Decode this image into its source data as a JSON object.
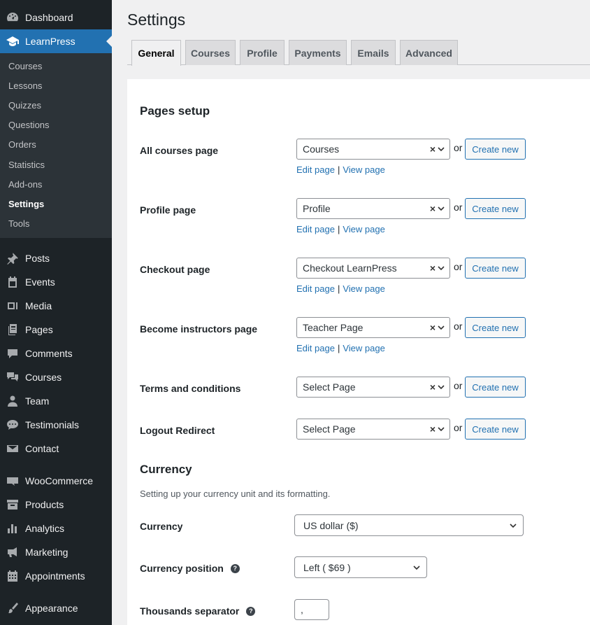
{
  "sidebar": {
    "top_items": [
      {
        "label": "Dashboard",
        "icon": "dashboard-icon"
      },
      {
        "label": "LearnPress",
        "icon": "graduation-cap-icon"
      }
    ],
    "learnpress_sub": [
      "Courses",
      "Lessons",
      "Quizzes",
      "Questions",
      "Orders",
      "Statistics",
      "Add-ons",
      "Settings",
      "Tools"
    ],
    "items_group1": [
      {
        "label": "Posts",
        "icon": "pushpin-icon"
      },
      {
        "label": "Events",
        "icon": "calendar-icon"
      },
      {
        "label": "Media",
        "icon": "media-icon"
      },
      {
        "label": "Pages",
        "icon": "pages-icon"
      },
      {
        "label": "Comments",
        "icon": "comment-icon"
      },
      {
        "label": "Courses",
        "icon": "comments-icon"
      },
      {
        "label": "Team",
        "icon": "person-icon"
      },
      {
        "label": "Testimonials",
        "icon": "speech-bubble-icon"
      },
      {
        "label": "Contact",
        "icon": "envelope-icon"
      }
    ],
    "items_group2": [
      {
        "label": "WooCommerce",
        "icon": "woo-icon"
      },
      {
        "label": "Products",
        "icon": "archive-icon"
      },
      {
        "label": "Analytics",
        "icon": "bar-chart-icon"
      },
      {
        "label": "Marketing",
        "icon": "megaphone-icon"
      },
      {
        "label": "Appointments",
        "icon": "calendar-grid-icon"
      }
    ],
    "items_group3": [
      {
        "label": "Appearance",
        "icon": "paintbrush-icon"
      }
    ]
  },
  "page": {
    "title": "Settings",
    "tabs": [
      "General",
      "Courses",
      "Profile",
      "Payments",
      "Emails",
      "Advanced"
    ]
  },
  "pages_setup": {
    "heading": "Pages setup",
    "rows": [
      {
        "label": "All courses page",
        "value": "Courses",
        "has_links": true
      },
      {
        "label": "Profile page",
        "value": "Profile",
        "has_links": true
      },
      {
        "label": "Checkout page",
        "value": "Checkout LearnPress",
        "has_links": true
      },
      {
        "label": "Become instructors page",
        "value": "Teacher Page",
        "has_links": true
      },
      {
        "label": "Terms and conditions",
        "value": "Select Page",
        "has_links": false
      },
      {
        "label": "Logout Redirect",
        "value": "Select Page",
        "has_links": false
      }
    ],
    "or_text": "or",
    "create_label": "Create new",
    "edit_label": "Edit page",
    "view_label": "View page",
    "link_sep": "|",
    "clear_glyph": "×"
  },
  "currency": {
    "heading": "Currency",
    "description": "Setting up your currency unit and its formatting.",
    "currency_label": "Currency",
    "currency_value": "US dollar ($)",
    "position_label": "Currency position",
    "position_value": "Left ( $69 )",
    "thousands_label": "Thousands separator",
    "thousands_value": ",",
    "help_glyph": "?"
  }
}
